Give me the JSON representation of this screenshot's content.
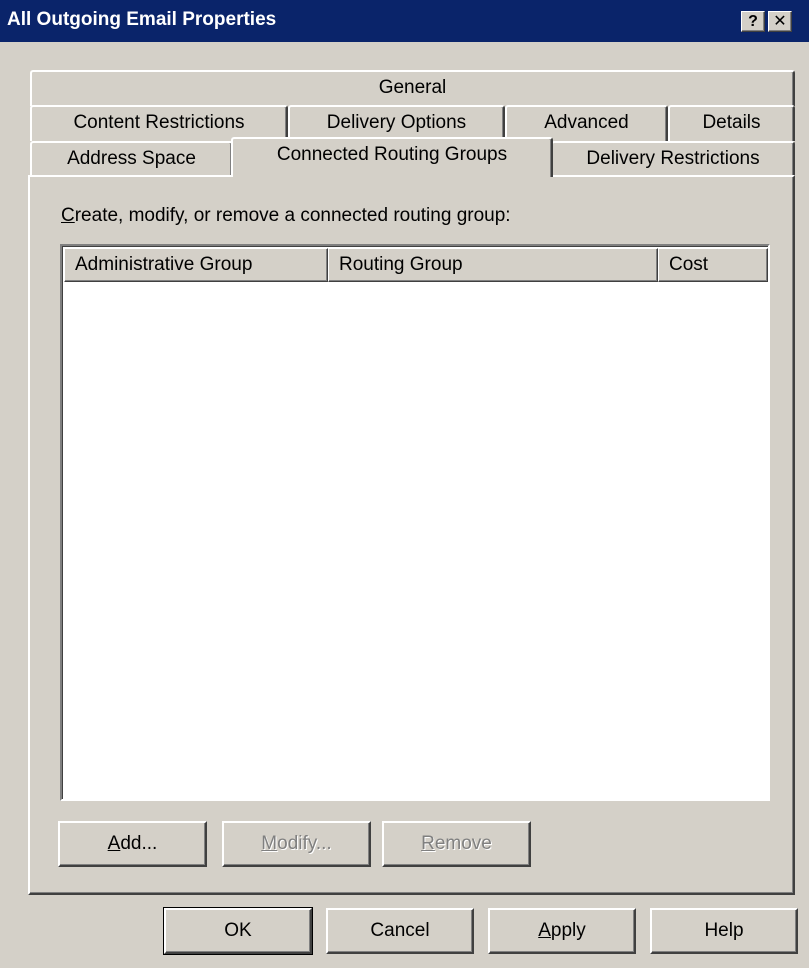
{
  "window": {
    "title": "All Outgoing Email Properties",
    "help_glyph": "?",
    "close_glyph": "✕"
  },
  "tabs": {
    "row1": [
      {
        "label": "General"
      }
    ],
    "row2": [
      {
        "label": "Content Restrictions"
      },
      {
        "label": "Delivery Options"
      },
      {
        "label": "Advanced"
      },
      {
        "label": "Details"
      }
    ],
    "row3": [
      {
        "label": "Address Space"
      },
      {
        "label": "Connected Routing Groups",
        "selected": true
      },
      {
        "label": "Delivery Restrictions"
      }
    ]
  },
  "panel": {
    "description_mnemonic": "C",
    "description_rest": "reate, modify, or remove a connected routing group:",
    "list": {
      "columns": [
        "Administrative Group",
        "Routing Group",
        "Cost"
      ],
      "rows": []
    },
    "buttons": {
      "add": {
        "mnemonic": "A",
        "rest": "dd...",
        "enabled": true
      },
      "modify": {
        "mnemonic": "M",
        "rest": "odify...",
        "enabled": false
      },
      "remove": {
        "mnemonic": "R",
        "rest": "emove",
        "enabled": false
      }
    }
  },
  "footer": {
    "ok": "OK",
    "cancel": "Cancel",
    "apply_mnemonic": "A",
    "apply_rest": "pply",
    "help": "Help"
  },
  "colors": {
    "titlebar": "#0a246a",
    "face": "#d4d0c8",
    "disabled_text": "#808080"
  }
}
